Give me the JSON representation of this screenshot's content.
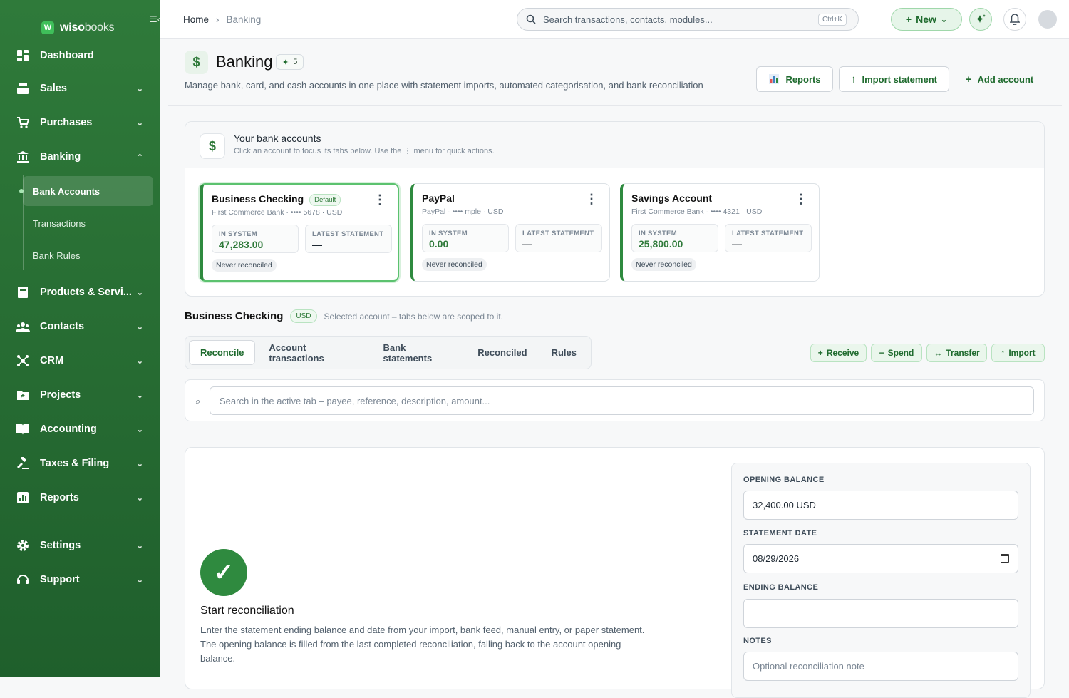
{
  "brand": {
    "name_bold": "wiso",
    "name_light": "books",
    "logo_letter": "W"
  },
  "sidebar": {
    "items": [
      {
        "label": "Dashboard",
        "icon": "dashboard-icon"
      },
      {
        "label": "Sales",
        "icon": "register-icon"
      },
      {
        "label": "Purchases",
        "icon": "cart-icon"
      },
      {
        "label": "Banking",
        "icon": "bank-icon",
        "expanded": true
      },
      {
        "label": "Products & Servi...",
        "icon": "box-icon"
      },
      {
        "label": "Contacts",
        "icon": "people-icon"
      },
      {
        "label": "CRM",
        "icon": "network-icon"
      },
      {
        "label": "Projects",
        "icon": "folder-star-icon"
      },
      {
        "label": "Accounting",
        "icon": "book-icon"
      },
      {
        "label": "Taxes & Filing",
        "icon": "gavel-icon"
      },
      {
        "label": "Reports",
        "icon": "chart-icon"
      },
      {
        "label": "Settings",
        "icon": "gear-icon"
      },
      {
        "label": "Support",
        "icon": "headset-icon"
      }
    ],
    "banking_sub": [
      {
        "label": "Bank Accounts",
        "active": true
      },
      {
        "label": "Transactions"
      },
      {
        "label": "Bank Rules"
      }
    ]
  },
  "topbar": {
    "breadcrumb_home": "Home",
    "breadcrumb_current": "Banking",
    "search_placeholder": "Search transactions, contacts, modules...",
    "search_shortcut": "Ctrl+K",
    "new_label": "New"
  },
  "page": {
    "title": "Banking",
    "badge_count": "5",
    "subtitle": "Manage bank, card, and cash accounts in one place with statement imports, automated categorisation, and bank reconciliation",
    "reports_label": "Reports",
    "import_label": "Import statement",
    "add_label": "Add account"
  },
  "accounts": {
    "title": "Your bank accounts",
    "subtitle": "Click an account to focus its tabs below. Use the ⋮ menu for quick actions.",
    "in_system_label": "IN SYSTEM",
    "latest_label": "LATEST STATEMENT",
    "cards": [
      {
        "name": "Business Checking",
        "default": "Default",
        "meta": "First Commerce Bank · •••• 5678 · USD",
        "in_system": "47,283.00",
        "latest": "—",
        "status": "Never reconciled"
      },
      {
        "name": "PayPal",
        "meta": "PayPal · •••• mple · USD",
        "in_system": "0.00",
        "latest": "—",
        "status": "Never reconciled"
      },
      {
        "name": "Savings Account",
        "meta": "First Commerce Bank · •••• 4321 · USD",
        "in_system": "25,800.00",
        "latest": "—",
        "status": "Never reconciled"
      }
    ]
  },
  "selected": {
    "name": "Business Checking",
    "currency": "USD",
    "note": "Selected account – tabs below are scoped to it."
  },
  "tabs": [
    "Reconcile",
    "Account transactions",
    "Bank statements",
    "Reconciled",
    "Rules"
  ],
  "quick_actions": [
    {
      "label": "Receive",
      "glyph": "+"
    },
    {
      "label": "Spend",
      "glyph": "−"
    },
    {
      "label": "Transfer",
      "glyph": "↔"
    },
    {
      "label": "Import",
      "glyph": "↑"
    }
  ],
  "tab_search_placeholder": "Search in the active tab – payee, reference, description, amount...",
  "reconcile": {
    "title": "Start reconciliation",
    "description": "Enter the statement ending balance and date from your import, bank feed, manual entry, or paper statement. The opening balance is filled from the last completed reconciliation, falling back to the account opening balance.",
    "opening_label": "OPENING BALANCE",
    "opening_value": "32,400.00 USD",
    "date_label": "STATEMENT DATE",
    "date_value": "08/29/2026",
    "ending_label": "ENDING BALANCE",
    "ending_value": "",
    "notes_label": "NOTES",
    "notes_placeholder": "Optional reconciliation note"
  },
  "colors": {
    "brand_green": "#2f7a3a",
    "accent_light": "#e6f5e9"
  }
}
